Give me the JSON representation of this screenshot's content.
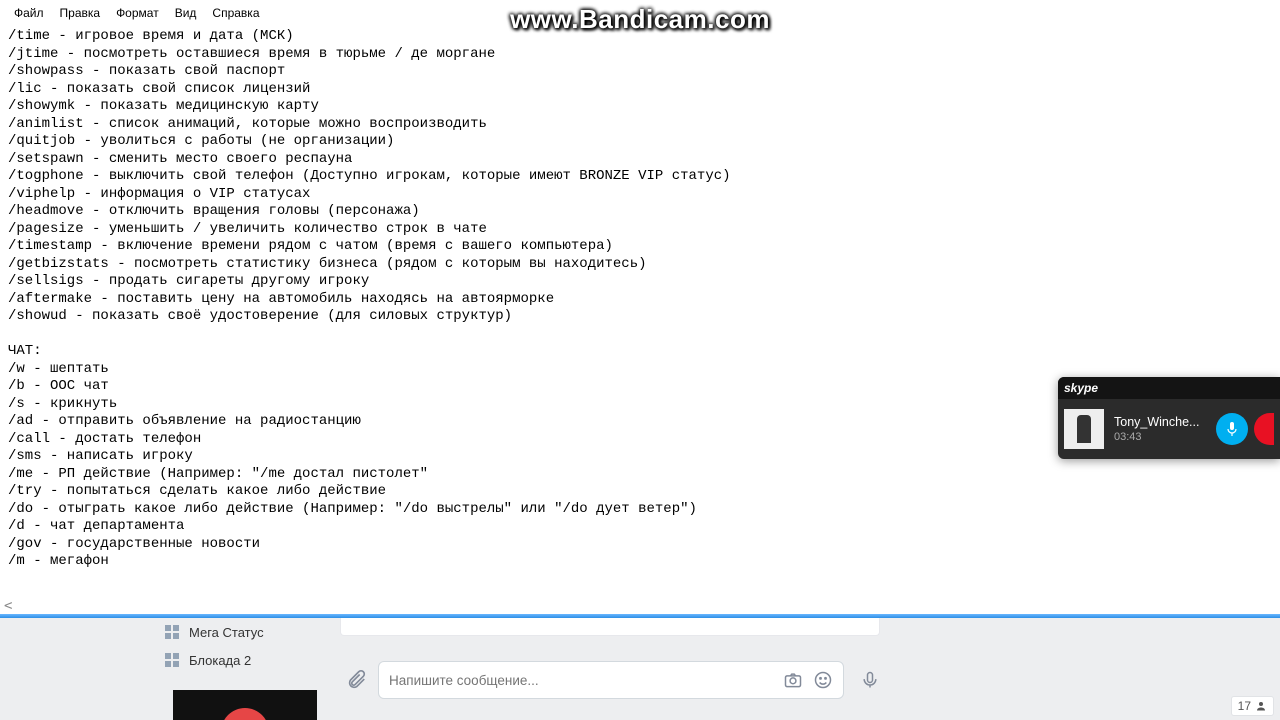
{
  "watermark": "www.Bandicam.com",
  "menu": {
    "items": [
      "Файл",
      "Правка",
      "Формат",
      "Вид",
      "Справка"
    ]
  },
  "lines": [
    "/time - игровое время и дата (МСК)",
    "/jtime - посмотреть оставшиеся время в тюрьме / де моргане",
    "/showpass - показать свой паспорт",
    "/lic - показать свой список лицензий",
    "/showymk - показать медицинскую карту",
    "/animlist - список анимаций, которые можно воспроизводить",
    "/quitjob - уволиться с работы (не организации)",
    "/setspawn - сменить место своего респауна",
    "/togphone - выключить свой телефон (Доступно игрокам, которые имеют BRONZE VIP статус)",
    "/viphelp - информация о VIP статусах",
    "/headmove - отключить вращения головы (персонажа)",
    "/pagesize - уменьшить / увеличить количество строк в чате",
    "/timestamp - включение времени рядом с чатом (время с вашего компьютера)",
    "/getbizstats - посмотреть статистику бизнеса (рядом с которым вы находитесь)",
    "/sellsigs - продать сигареты другому игроку",
    "/aftermake - поставить цену на автомобиль находясь на автоярморке",
    "/showud - показать своё удостоверение (для силовых структур)",
    "",
    "ЧАТ:",
    "/w - шептать",
    "/b - OOC чат",
    "/s - крикнуть",
    "/ad - отправить объявление на радиостанцию",
    "/call - достать телефон",
    "/sms - написать игроку",
    "/me - РП действие (Например: \"/me достал пистолет\"",
    "/try - попытаться сделать какое либо действие",
    "/do - отыграть какое либо действие (Например: \"/do выстрелы\" или \"/do дует ветер\")",
    "/d - чат департамента",
    "/gov - государственные новости",
    "/m - мегафон"
  ],
  "scroll_hint": "<",
  "skype": {
    "logo": "skype",
    "name": "Tony_Winche...",
    "duration": "03:43"
  },
  "vk": {
    "sidebar": [
      "Мега Статус",
      "Блокада 2"
    ],
    "placeholder": "Напишите сообщение...",
    "online_count": "17"
  }
}
